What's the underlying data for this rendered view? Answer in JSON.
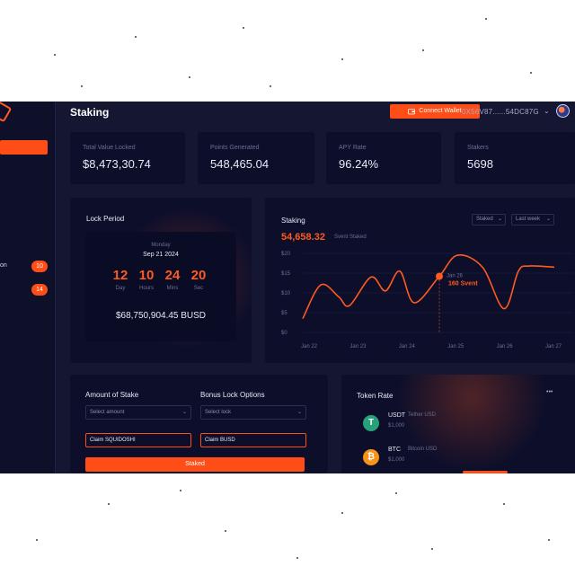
{
  "header": {
    "title": "Staking",
    "connect_label": "Connect Wallet",
    "wallet_address": "0X56V87......54DC87G"
  },
  "sidebar": {
    "items": [
      {
        "label": "on",
        "badge": "10"
      },
      {
        "label": "",
        "badge": "14"
      }
    ]
  },
  "stats": [
    {
      "label": "Total Value Locked",
      "value": "$8,473,30.74"
    },
    {
      "label": "Points Generated",
      "value": "548,465.04"
    },
    {
      "label": "APY Rate",
      "value": "96.24%"
    },
    {
      "label": "Stakers",
      "value": "5698"
    }
  ],
  "lock_period": {
    "title": "Lock Period",
    "weekday": "Monday",
    "date": "Sep 21 2024",
    "countdown": [
      {
        "value": "12",
        "unit": "Day"
      },
      {
        "value": "10",
        "unit": "Hours"
      },
      {
        "value": "24",
        "unit": "Mins"
      },
      {
        "value": "20",
        "unit": "Sec"
      }
    ],
    "amount": "$68,750,904.45 BUSD"
  },
  "staking_chart": {
    "title": "Staking",
    "value": "54,658.32",
    "unit": "Svent Staked",
    "filter_type": "Staked",
    "filter_period": "Last week",
    "tooltip_date": "Jan 26",
    "tooltip_value": "160 Svent"
  },
  "chart_data": {
    "type": "line",
    "title": "",
    "xlabel": "",
    "ylabel": "",
    "x_ticks": [
      "Jan 22",
      "Jan 23",
      "Jan 24",
      "Jan 25",
      "Jan 26",
      "Jan 27"
    ],
    "y_ticks": [
      "$20",
      "$15",
      "$10",
      "$5",
      "$0"
    ],
    "ylim": [
      0,
      20
    ],
    "grid": true,
    "series": [
      {
        "color": "#ff5a1f",
        "points": [
          {
            "x": 0.0,
            "y": 3.5
          },
          {
            "x": 0.5,
            "y": 12.0
          },
          {
            "x": 1.0,
            "y": 9.0
          },
          {
            "x": 1.3,
            "y": 6.8
          },
          {
            "x": 1.9,
            "y": 14.0
          },
          {
            "x": 2.3,
            "y": 10.5
          },
          {
            "x": 2.7,
            "y": 15.5
          },
          {
            "x": 3.1,
            "y": 7.5
          },
          {
            "x": 3.8,
            "y": 14.2
          },
          {
            "x": 4.3,
            "y": 19.5
          },
          {
            "x": 5.0,
            "y": 16.5
          },
          {
            "x": 5.6,
            "y": 6.0
          },
          {
            "x": 6.0,
            "y": 15.5
          },
          {
            "x": 6.3,
            "y": 16.8
          },
          {
            "x": 7.0,
            "y": 16.5
          }
        ]
      }
    ],
    "highlight": {
      "x": 3.8,
      "y": 14.2
    },
    "x_range": [
      0,
      7
    ]
  },
  "stake_form": {
    "amount_label": "Amount of Stake",
    "bonus_label": "Bonus Lock Options",
    "amount_placeholder": "Select amount",
    "lock_placeholder": "Select lock",
    "claim_left": "Claim SQUIDOSHI",
    "claim_right": "Claim BUSD",
    "stake_button": "Staked"
  },
  "token_rate": {
    "title": "Token Rate",
    "more": "•••",
    "tokens": [
      {
        "symbol": "USDT",
        "name": "Tether USD",
        "price": "$1,000",
        "icon": "T",
        "color": "#26a17b"
      },
      {
        "symbol": "BTC",
        "name": "Bitcoin USD",
        "price": "$1,000",
        "icon": "₿",
        "color": "#f7931a"
      }
    ]
  }
}
